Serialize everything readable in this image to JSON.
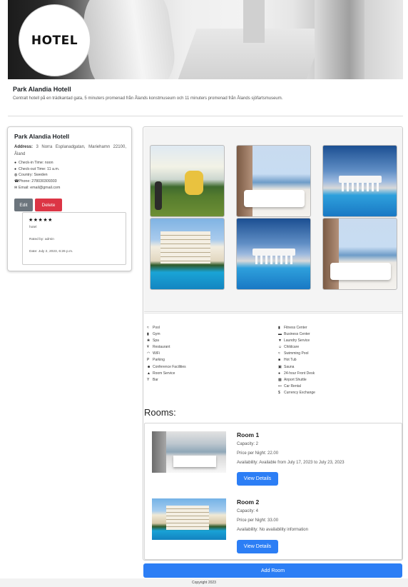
{
  "header": {
    "logo_text": "HOTEL",
    "hotel_name": "Park Alandia Hotell",
    "description": "Centralt hotell på en trädkantad gata, 5 minuters promenad från Ålands konstmuseum och 11 minuters promenad från Ålands sjöfartsmuseum."
  },
  "info_card": {
    "title": "Park Alandia Hotell",
    "address_label": "Address:",
    "address_value": " 3 Norra Esplanadgatan, Mariehamn 22100, Åland",
    "lines": [
      {
        "icon": "clock-icon",
        "text": "Check-in Time: noon"
      },
      {
        "icon": "clock-icon",
        "text": "Check-out Time: 11 a.m."
      },
      {
        "icon": "globe-icon",
        "text": "Country: Sweden"
      },
      {
        "icon": "phone-icon",
        "text": "Phone: 278030309303"
      },
      {
        "icon": "envelope-icon",
        "text": "Email: email@gmail.com"
      }
    ],
    "edit_label": "Edit",
    "delete_label": "Delete"
  },
  "review": {
    "stars": "★★★★★",
    "rating": 5,
    "text": "hotel",
    "rated_by": "Rated by: admin",
    "date": "Date: July 2, 2023, 6:26 p.m."
  },
  "amenities": {
    "left": [
      {
        "icon": "swimmer-icon",
        "label": "Pool"
      },
      {
        "icon": "dumbbell-icon",
        "label": "Gym"
      },
      {
        "icon": "spa-icon",
        "label": "Spa"
      },
      {
        "icon": "utensils-icon",
        "label": "Restaurant"
      },
      {
        "icon": "wifi-icon",
        "label": "WiFi"
      },
      {
        "icon": "parking-icon",
        "label": "Parking"
      },
      {
        "icon": "users-icon",
        "label": "Conference Facilities"
      },
      {
        "icon": "bell-icon",
        "label": "Room Service"
      },
      {
        "icon": "cocktail-icon",
        "label": "Bar"
      }
    ],
    "right": [
      {
        "icon": "dumbbell-icon",
        "label": "Fitness Center"
      },
      {
        "icon": "briefcase-icon",
        "label": "Business Center"
      },
      {
        "icon": "shirt-icon",
        "label": "Laundry Service"
      },
      {
        "icon": "child-icon",
        "label": "Childcare"
      },
      {
        "icon": "swimmer-icon",
        "label": "Swimming Pool"
      },
      {
        "icon": "hot-tub-icon",
        "label": "Hot Tub"
      },
      {
        "icon": "sauna-icon",
        "label": "Sauna"
      },
      {
        "icon": "clock-icon",
        "label": "24-hour Front Desk"
      },
      {
        "icon": "shuttle-icon",
        "label": "Airport Shuttle"
      },
      {
        "icon": "car-icon",
        "label": "Car Rental"
      },
      {
        "icon": "dollar-icon",
        "label": "Currency Exchange"
      }
    ]
  },
  "rooms": {
    "heading": "Rooms:",
    "items": [
      {
        "title": "Room 1",
        "capacity": "Capacity: 2",
        "price": "Price per Night: 22.00",
        "availability": "Availability: Available from July 17, 2023 to July 23, 2023",
        "button": "View Details"
      },
      {
        "title": "Room 2",
        "capacity": "Capacity: 4",
        "price": "Price per Night: 33.00",
        "availability": "Availability: No availability information",
        "button": "View Details"
      }
    ],
    "add_room_label": "Add Room"
  },
  "footer": {
    "copyright": "Copyright 2023"
  }
}
